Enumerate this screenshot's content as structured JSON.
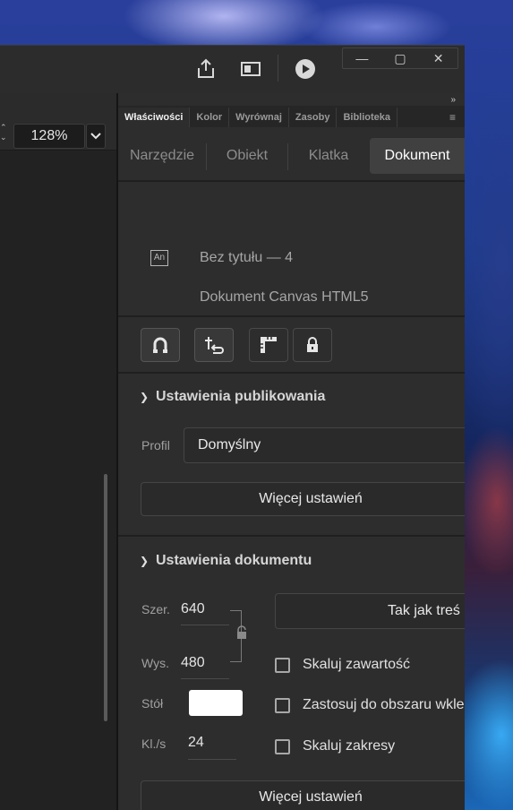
{
  "titlebar": {
    "icons": [
      "share-icon",
      "panel-layout-icon",
      "play-icon"
    ],
    "window_controls": [
      "minimize",
      "maximize",
      "close"
    ]
  },
  "left_toolbar": {
    "zoom_value": "128%"
  },
  "panel_tabs": [
    "Właściwości",
    "Kolor",
    "Wyrównaj",
    "Zasoby",
    "Biblioteka"
  ],
  "property_tabs": [
    "Narzędzie",
    "Obiekt",
    "Klatka",
    "Dokument"
  ],
  "active_property_tab": "Dokument",
  "document": {
    "icon_text": "An",
    "title": "Bez tytułu — 4",
    "type": "Dokument Canvas HTML5"
  },
  "tool_buttons": [
    "magnet-icon",
    "pen-adjust-icon",
    "ruler-icon",
    "lock-icon"
  ],
  "publish_settings": {
    "title": "Ustawienia publikowania",
    "profile_label": "Profil",
    "profile_value": "Domyślny",
    "more_button": "Więcej ustawień"
  },
  "document_settings": {
    "title": "Ustawienia dokumentu",
    "width_label": "Szer.",
    "width_value": "640",
    "height_label": "Wys.",
    "height_value": "480",
    "stage_label": "Stół",
    "stage_color": "#ffffff",
    "fps_label": "Kl./s",
    "fps_value": "24",
    "match_contents_button": "Tak jak treś",
    "checkboxes": [
      "Skaluj zawartość",
      "Zastosuj do obszaru wkle",
      "Skaluj zakresy"
    ],
    "more_button": "Więcej ustawień"
  }
}
